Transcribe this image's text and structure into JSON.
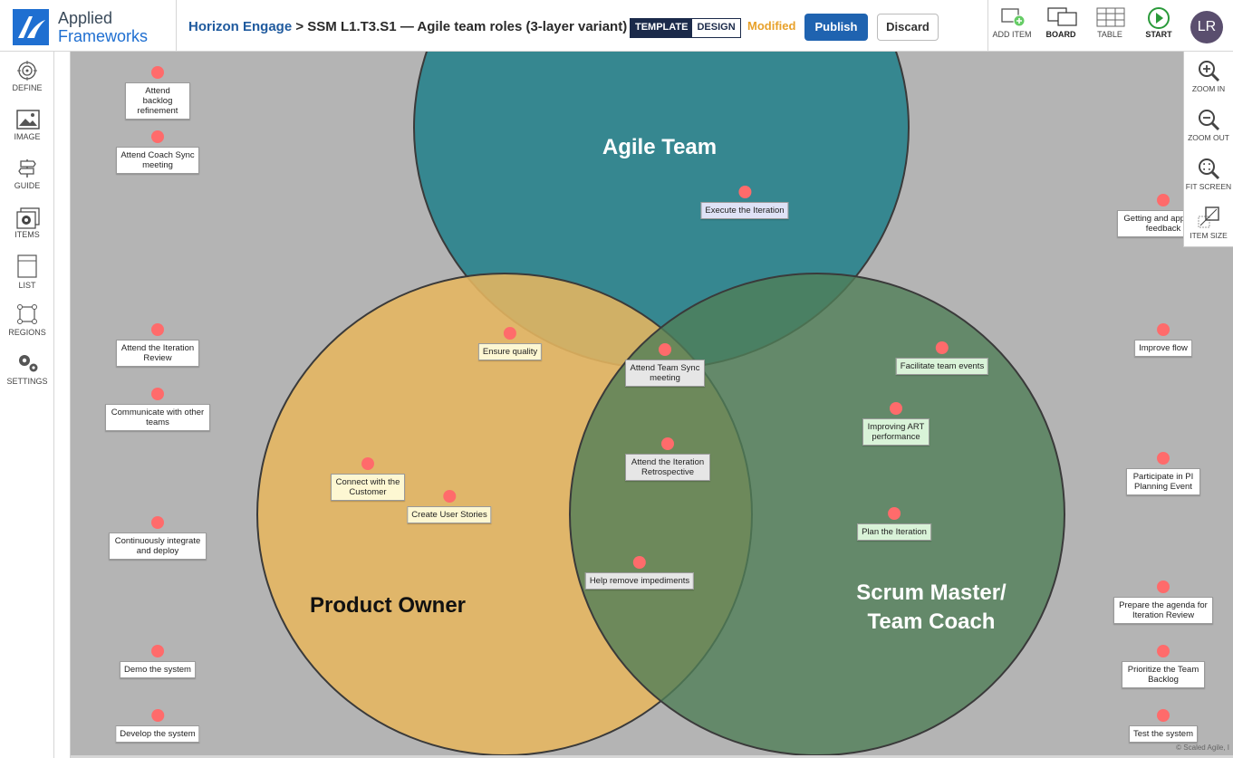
{
  "logo": {
    "line1": "Applied",
    "line2": "Frameworks"
  },
  "breadcrumb": {
    "project": "Horizon Engage",
    "separator": " > ",
    "page": "SSM L1.T3.S1 — Agile team roles (3-layer variant)"
  },
  "mode_toggle": {
    "template": "TEMPLATE",
    "design": "DESIGN"
  },
  "status": "Modified",
  "buttons": {
    "publish": "Publish",
    "discard": "Discard"
  },
  "toolbar": {
    "add_item": "ADD ITEM",
    "board": "BOARD",
    "table": "TABLE",
    "start": "START"
  },
  "user": {
    "initials": "LR"
  },
  "sidebar": {
    "items": [
      {
        "label": "DEFINE",
        "icon": "target-icon"
      },
      {
        "label": "IMAGE",
        "icon": "image-icon"
      },
      {
        "label": "GUIDE",
        "icon": "signpost-icon"
      },
      {
        "label": "ITEMS",
        "icon": "items-gear-icon"
      },
      {
        "label": "LIST",
        "icon": "list-icon"
      },
      {
        "label": "REGIONS",
        "icon": "regions-icon"
      },
      {
        "label": "SETTINGS",
        "icon": "settings-icon"
      }
    ]
  },
  "zoom": {
    "zoom_in": "ZOOM IN",
    "zoom_out": "ZOOM OUT",
    "fit_screen": "FIT SCREEN",
    "item_size": "ITEM SIZE"
  },
  "regions": {
    "team": "Agile Team",
    "po": "Product Owner",
    "sm_line1": "Scrum Master/",
    "sm_line2": "Team Coach"
  },
  "items": {
    "attend_backlog": "Attend backlog refinement",
    "attend_coach_sync": "Attend Coach Sync meeting",
    "attend_iteration_review": "Attend the Iteration Review",
    "communicate": "Communicate with other teams",
    "continuously": "Continuously integrate and deploy",
    "demo": "Demo the system",
    "develop": "Develop the system",
    "execute_iteration": "Execute the Iteration",
    "ensure_quality": "Ensure quality",
    "team_sync": "Attend Team Sync meeting",
    "retro": "Attend the Iteration Retrospective",
    "connect_customer": "Connect with the Customer",
    "create_stories": "Create User Stories",
    "remove_impediments": "Help remove impediments",
    "facilitate": "Facilitate team events",
    "improving_art": "Improving ART performance",
    "plan_iteration": "Plan the Iteration",
    "feedback": "Getting and applying feedback",
    "improve_flow": "Improve flow",
    "pi_planning": "Participate in PI Planning Event",
    "agenda": "Prepare the agenda for Iteration Review",
    "prioritize": "Prioritize the Team Backlog",
    "test": "Test the system"
  },
  "copyright": "© Scaled Agile, I",
  "colors": {
    "accent": "#1f63b0",
    "modified": "#e8a12a",
    "team": "#1a7c87",
    "po": "#e6b660",
    "sm": "#507e58",
    "dot": "#ff6b6b"
  }
}
